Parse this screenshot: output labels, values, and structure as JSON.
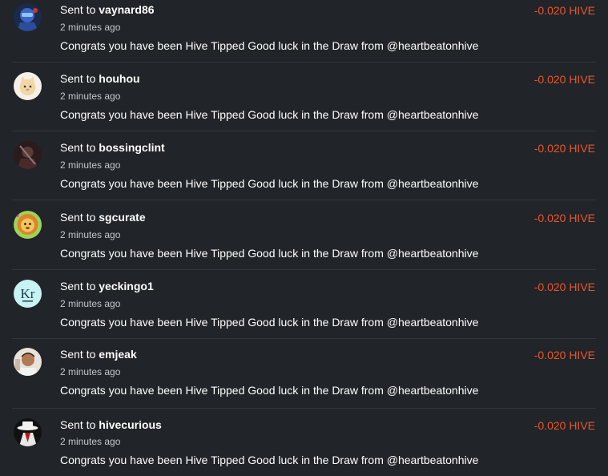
{
  "transactions": [
    {
      "sent_prefix": "Sent to",
      "recipient": "vaynard86",
      "time": "2 minutes ago",
      "memo": "Congrats you have been Hive Tipped Good luck in the Draw from @heartbeatonhive",
      "amount": "-0.020 HIVE",
      "avatar_icon": "robot-avatar-icon"
    },
    {
      "sent_prefix": "Sent to",
      "recipient": "houhou",
      "time": "2 minutes ago",
      "memo": "Congrats you have been Hive Tipped Good luck in the Draw from @heartbeatonhive",
      "amount": "-0.020 HIVE",
      "avatar_icon": "cat-avatar-icon"
    },
    {
      "sent_prefix": "Sent to",
      "recipient": "bossingclint",
      "time": "2 minutes ago",
      "memo": "Congrats you have been Hive Tipped Good luck in the Draw from @heartbeatonhive",
      "amount": "-0.020 HIVE",
      "avatar_icon": "dark-figure-avatar-icon"
    },
    {
      "sent_prefix": "Sent to",
      "recipient": "sgcurate",
      "time": "2 minutes ago",
      "memo": "Congrats you have been Hive Tipped Good luck in the Draw from @heartbeatonhive",
      "amount": "-0.020 HIVE",
      "avatar_icon": "lion-avatar-icon"
    },
    {
      "sent_prefix": "Sent to",
      "recipient": "yeckingo1",
      "time": "2 minutes ago",
      "memo": "Congrats you have been Hive Tipped Good luck in the Draw from @heartbeatonhive",
      "amount": "-0.020 HIVE",
      "avatar_icon": "kr-logo-avatar-icon",
      "avatar_text": "Kr"
    },
    {
      "sent_prefix": "Sent to",
      "recipient": "emjeak",
      "time": "2 minutes ago",
      "memo": "Congrats you have been Hive Tipped Good luck in the Draw from @heartbeatonhive",
      "amount": "-0.020 HIVE",
      "avatar_icon": "person-avatar-icon"
    },
    {
      "sent_prefix": "Sent to",
      "recipient": "hivecurious",
      "time": "2 minutes ago",
      "memo": "Congrats you have been Hive Tipped Good luck in the Draw from @heartbeatonhive",
      "amount": "-0.020 HIVE",
      "avatar_icon": "hat-figure-avatar-icon"
    }
  ],
  "colors": {
    "background": "#212428",
    "amount_negative": "#e8582d",
    "divider": "#33373d",
    "text": "#ffffff",
    "muted_text": "#c5c8cc"
  }
}
